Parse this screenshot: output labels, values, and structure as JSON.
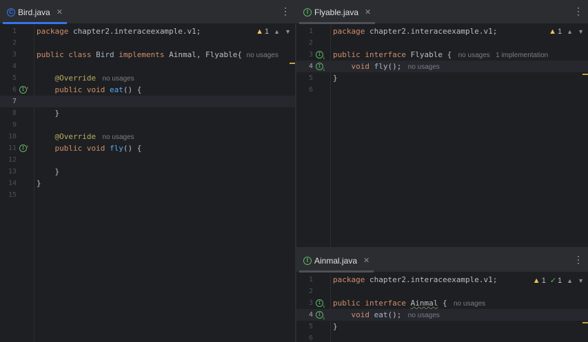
{
  "left": {
    "tab": {
      "icon": "C",
      "title": "Bird.java",
      "close": "✕",
      "menu": "⋮"
    },
    "inspections": {
      "warnings": "1"
    },
    "lines": [
      {
        "n": "1",
        "segs": [
          [
            "kw",
            "package "
          ],
          [
            "",
            "chapter2.interaceexample.v1;"
          ]
        ]
      },
      {
        "n": "2",
        "segs": []
      },
      {
        "n": "3",
        "segs": [
          [
            "kw",
            "public class "
          ],
          [
            "decl",
            "Bird "
          ],
          [
            "kw",
            "implements "
          ],
          [
            "",
            "Ainmal, Flyable{ "
          ],
          [
            "hint",
            "no usages"
          ]
        ]
      },
      {
        "n": "4",
        "segs": []
      },
      {
        "n": "5",
        "segs": [
          [
            "",
            "    "
          ],
          [
            "ann",
            "@Override "
          ],
          [
            "hint",
            " no usages"
          ]
        ]
      },
      {
        "n": "6",
        "segs": [
          [
            "",
            "    "
          ],
          [
            "kw",
            "public void "
          ],
          [
            "fn",
            "eat"
          ],
          [
            "",
            "() {"
          ]
        ],
        "icon": "impl-up"
      },
      {
        "n": "7",
        "segs": [],
        "current": true
      },
      {
        "n": "8",
        "segs": [
          [
            "",
            "    }"
          ]
        ]
      },
      {
        "n": "9",
        "segs": []
      },
      {
        "n": "10",
        "segs": [
          [
            "",
            "    "
          ],
          [
            "ann",
            "@Override "
          ],
          [
            "hint",
            " no usages"
          ]
        ]
      },
      {
        "n": "11",
        "segs": [
          [
            "",
            "    "
          ],
          [
            "kw",
            "public void "
          ],
          [
            "fn",
            "fly"
          ],
          [
            "",
            "() {"
          ]
        ],
        "icon": "impl-up"
      },
      {
        "n": "12",
        "segs": []
      },
      {
        "n": "13",
        "segs": [
          [
            "",
            "    }"
          ]
        ]
      },
      {
        "n": "14",
        "segs": [
          [
            "",
            "}"
          ]
        ]
      },
      {
        "n": "15",
        "segs": []
      }
    ]
  },
  "right_top": {
    "tab": {
      "icon": "I",
      "title": "Flyable.java",
      "close": "✕",
      "menu": "⋮"
    },
    "inspections": {
      "warnings": "1"
    },
    "lines": [
      {
        "n": "1",
        "segs": [
          [
            "kw",
            "package "
          ],
          [
            "",
            "chapter2.interaceexample.v1;"
          ]
        ]
      },
      {
        "n": "2",
        "segs": []
      },
      {
        "n": "3",
        "segs": [
          [
            "kw",
            "public interface "
          ],
          [
            "",
            "Flyable { "
          ],
          [
            "hint",
            " no usages   1 implementation"
          ]
        ],
        "icon": "impl-down"
      },
      {
        "n": "4",
        "segs": [
          [
            "",
            "    "
          ],
          [
            "kw",
            "void "
          ],
          [
            "decl",
            "fly"
          ],
          [
            "",
            "(); "
          ],
          [
            "hint",
            " no usages"
          ]
        ],
        "icon": "impl-down",
        "current": true
      },
      {
        "n": "5",
        "segs": [
          [
            "",
            "}"
          ]
        ]
      },
      {
        "n": "6",
        "segs": []
      }
    ]
  },
  "right_bottom": {
    "tab": {
      "icon": "I",
      "title": "Ainmal.java",
      "close": "✕",
      "menu": "⋮"
    },
    "inspections": {
      "warnings": "1",
      "ok": "1"
    },
    "lines": [
      {
        "n": "1",
        "segs": [
          [
            "kw",
            "package "
          ],
          [
            "",
            "chapter2.interaceexample.v1;"
          ]
        ]
      },
      {
        "n": "2",
        "segs": []
      },
      {
        "n": "3",
        "segs": [
          [
            "kw",
            "public interface "
          ],
          [
            "under",
            "Ainmal"
          ],
          [
            "",
            " { "
          ],
          [
            "hint",
            " no usages"
          ]
        ],
        "icon": "impl-down"
      },
      {
        "n": "4",
        "segs": [
          [
            "",
            "    "
          ],
          [
            "kw",
            "void "
          ],
          [
            "decl",
            "eat"
          ],
          [
            "",
            "(); "
          ],
          [
            "hint",
            " no usages"
          ]
        ],
        "icon": "impl-down",
        "current": true
      },
      {
        "n": "5",
        "segs": [
          [
            "",
            "}"
          ]
        ]
      },
      {
        "n": "6",
        "segs": []
      }
    ]
  },
  "colors": {
    "class_tab_icon": "#3574f0",
    "interface_tab_icon": "#5fb865",
    "active_underline": "#3574f0",
    "inactive_underline": "#4e5157"
  }
}
